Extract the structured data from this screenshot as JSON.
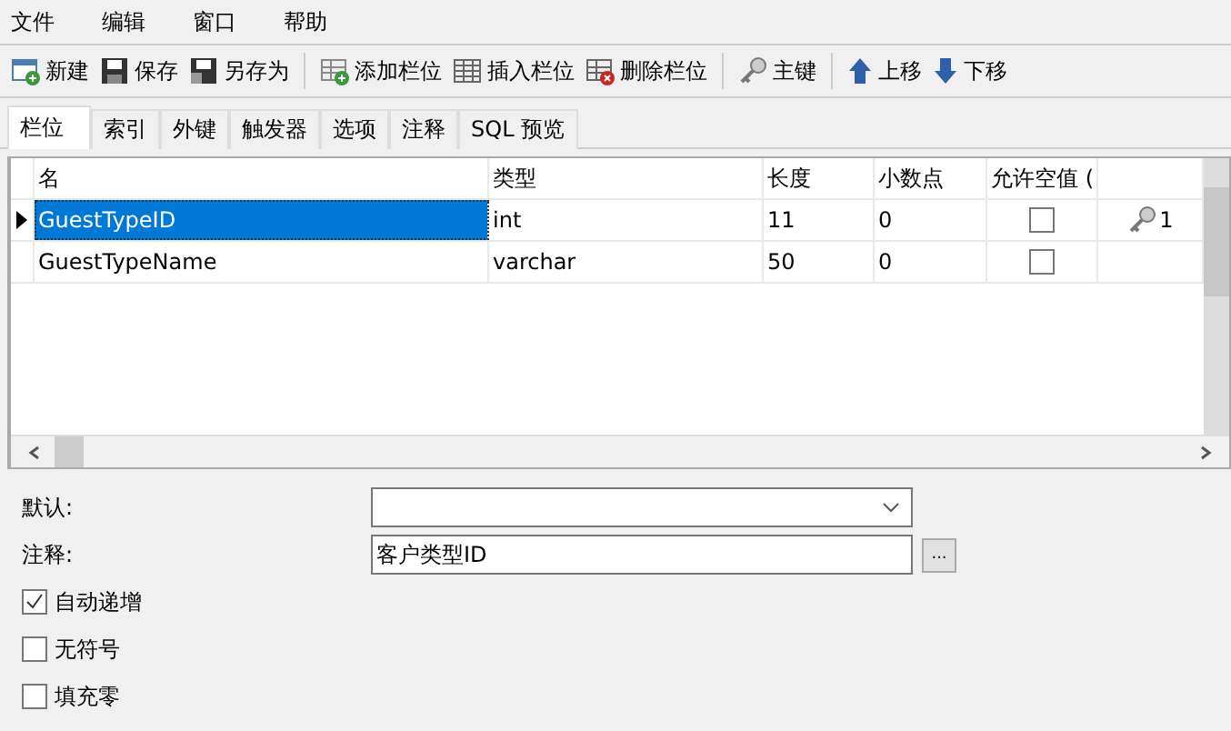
{
  "menu": [
    "文件",
    "编辑",
    "窗口",
    "帮助"
  ],
  "toolbar": [
    {
      "label": "新建"
    },
    {
      "label": "保存"
    },
    {
      "label": "另存为"
    },
    {
      "kind": "sep"
    },
    {
      "label": "添加栏位"
    },
    {
      "label": "插入栏位"
    },
    {
      "label": "删除栏位"
    },
    {
      "kind": "sep"
    },
    {
      "label": "主键"
    },
    {
      "kind": "sep"
    },
    {
      "label": "上移"
    },
    {
      "label": "下移"
    }
  ],
  "tabs": [
    {
      "label": "栏位",
      "selected": true
    },
    {
      "label": "索引",
      "selected": false
    },
    {
      "label": "外键",
      "selected": false
    },
    {
      "label": "触发器",
      "selected": false
    },
    {
      "label": "选项",
      "selected": false
    },
    {
      "label": "注释",
      "selected": false
    },
    {
      "label": "SQL 预览",
      "selected": false
    }
  ],
  "table": {
    "columns": [
      "名",
      "类型",
      "长度",
      "小数点",
      "允许空值 ("
    ],
    "rows": [
      {
        "name": "GuestTypeID",
        "type": "int",
        "length": "11",
        "decimals": "0",
        "allow_null": false,
        "key": "1",
        "selected": true
      },
      {
        "name": "GuestTypeName",
        "type": "varchar",
        "length": "50",
        "decimals": "0",
        "allow_null": false,
        "selected": false
      }
    ]
  },
  "form": {
    "default_label": "默认:",
    "comment_label": "注释:",
    "comment_value": "客户类型ID",
    "browse_button": "...",
    "options": [
      {
        "label": "自动递增",
        "checked": true
      },
      {
        "label": "无符号",
        "checked": false
      },
      {
        "label": "填充零",
        "checked": false
      }
    ]
  }
}
